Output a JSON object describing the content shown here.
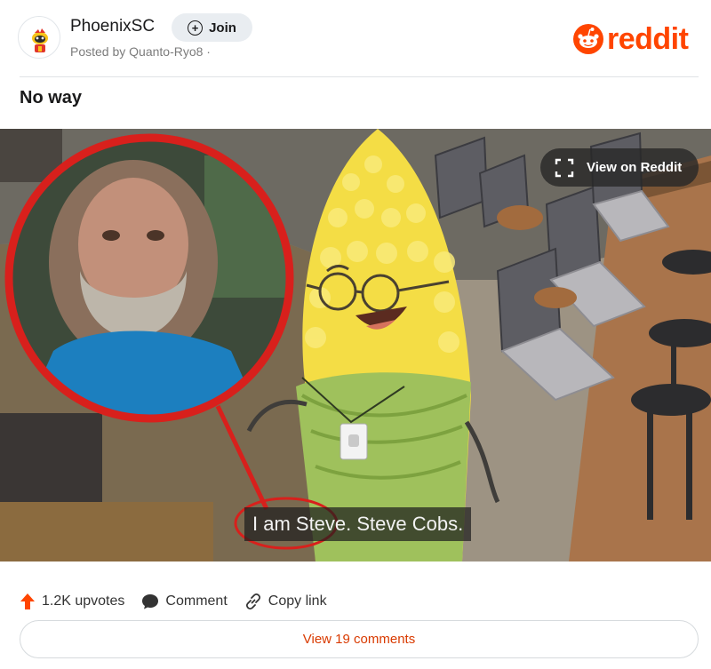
{
  "header": {
    "subreddit": "PhoenixSC",
    "join_label": "Join",
    "posted_by": "Posted by Quanto-Ryo8 ·",
    "brand": "reddit"
  },
  "post": {
    "title": "No way"
  },
  "media": {
    "view_on_reddit_label": "View on Reddit",
    "subtitle": "I am Steve. Steve Cobs."
  },
  "actions": {
    "upvotes": "1.2K upvotes",
    "comment": "Comment",
    "copy_link": "Copy link",
    "view_comments": "View 19 comments"
  },
  "colors": {
    "brand": "#ff4500",
    "circle_highlight": "#d8201c",
    "view_comments_text": "#d93a00"
  }
}
